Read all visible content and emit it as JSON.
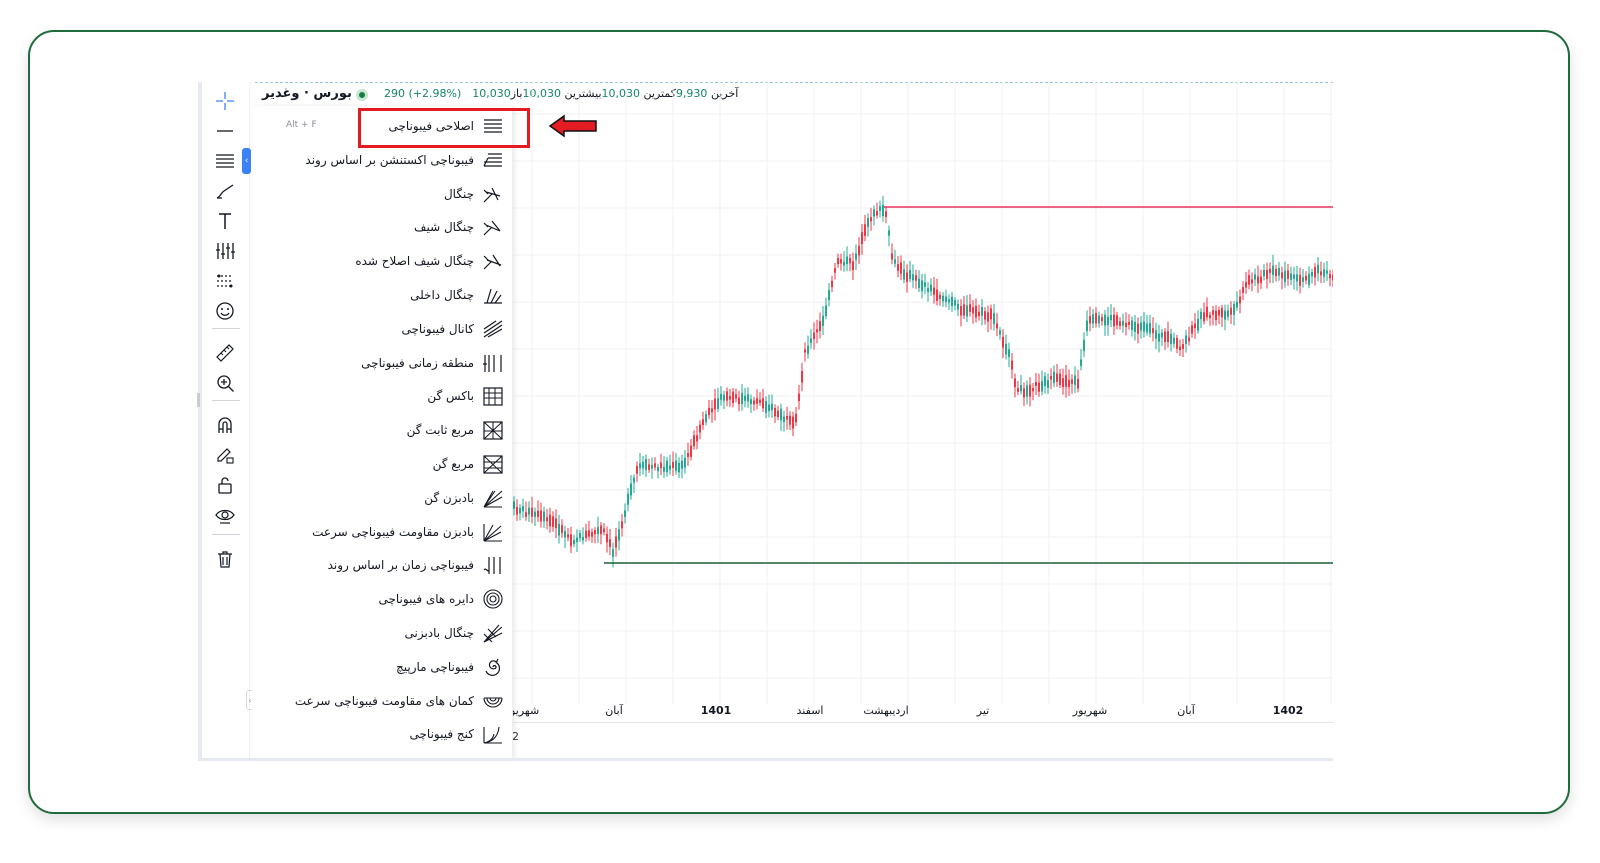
{
  "header": {
    "symbol": "بورس · وغدیر",
    "open_label": "باز",
    "open_value": "10,030",
    "high_label": "بیشترین",
    "high_value": "10,030",
    "low_label": "کمترین",
    "low_value": "9,930",
    "close_label": "آخرین",
    "close_value": "10,030",
    "change": "290 (+2.98%)"
  },
  "menu": {
    "shortcut": "Alt + F",
    "items": [
      {
        "label": "اصلاحی فیبوناچی",
        "icon": "fib-retracement-icon"
      },
      {
        "label": "فیبوناچی اکستنشن بر اساس روند",
        "icon": "fib-extension-icon"
      },
      {
        "label": "چنگال",
        "icon": "pitchfork-icon"
      },
      {
        "label": "چنگال شیف",
        "icon": "schiff-pitchfork-icon"
      },
      {
        "label": "چنگال شیف اصلاح شده",
        "icon": "modified-schiff-pitchfork-icon"
      },
      {
        "label": "چنگال داخلی",
        "icon": "inside-pitchfork-icon"
      },
      {
        "label": "کانال فیبوناچی",
        "icon": "fib-channel-icon"
      },
      {
        "label": "منطقه زمانی فیبوناچی",
        "icon": "fib-time-zone-icon"
      },
      {
        "label": "باکس گن",
        "icon": "gann-box-icon"
      },
      {
        "label": "مربع ثابت گن",
        "icon": "gann-square-fixed-icon"
      },
      {
        "label": "مربع گن",
        "icon": "gann-square-icon"
      },
      {
        "label": "بادبزن گن",
        "icon": "gann-fan-icon"
      },
      {
        "label": "بادبزن مقاومت فیبوناچی سرعت",
        "icon": "fib-speed-fan-icon"
      },
      {
        "label": "فیبوناچی زمان بر اساس روند",
        "icon": "trend-fib-time-icon"
      },
      {
        "label": "دایره های فیبوناچی",
        "icon": "fib-circles-icon"
      },
      {
        "label": "چنگال بادبزنی",
        "icon": "pitchfan-icon"
      },
      {
        "label": "فیبوناچی مارپیچ",
        "icon": "fib-spiral-icon"
      },
      {
        "label": "کمان های مقاومت فیبوناچی سرعت",
        "icon": "fib-speed-arcs-icon"
      },
      {
        "label": "کنج فیبوناچی",
        "icon": "fib-wedge-icon"
      }
    ]
  },
  "toolbar": {
    "tools": [
      "crosshair-icon",
      "line-tool-icon",
      "fib-tools-icon",
      "brush-icon",
      "text-tool-icon",
      "patterns-icon",
      "prediction-icon",
      "emoji-icon",
      "ruler-icon",
      "zoom-in-icon",
      "magnet-icon",
      "stay-drawing-icon",
      "lock-icon",
      "eye-icon",
      "trash-icon"
    ]
  },
  "chart_data": {
    "type": "candlestick",
    "x_tick_labels": [
      "شهریور",
      "آبان",
      "1401",
      "اسفند",
      "اردیبهشت",
      "تیر",
      "شهریور",
      "آبان",
      "1402"
    ],
    "horizontal_lines": [
      {
        "color": "#e8365d",
        "level": "high"
      },
      {
        "color": "#1f5e38",
        "level": "low"
      }
    ],
    "up_color": "#22ab94",
    "down_color": "#f23645"
  },
  "bottom_hint": "2"
}
